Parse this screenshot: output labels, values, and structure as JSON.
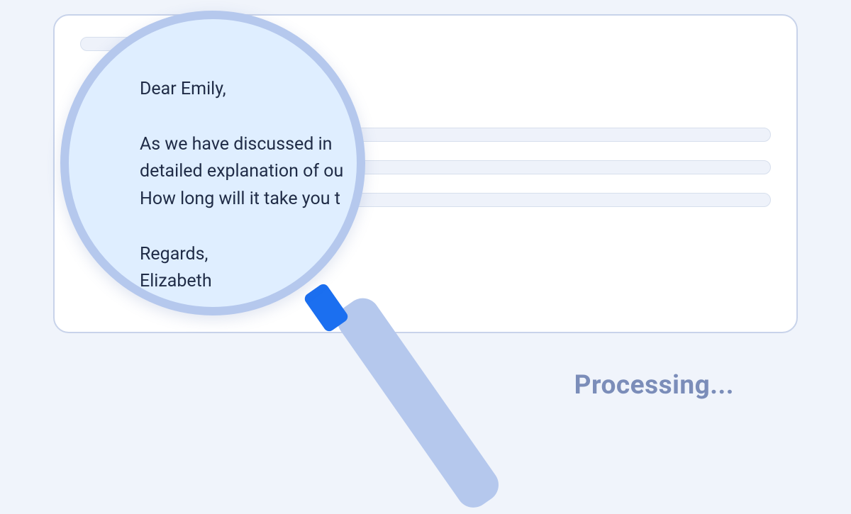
{
  "email": {
    "greeting": "Dear Emily,",
    "body_line1": "As we have discussed in",
    "body_line2": "detailed explanation of ou",
    "body_line3": "How long will it take you t",
    "signoff": "Regards,",
    "sender": "Elizabeth"
  },
  "status_text": "Processing..."
}
